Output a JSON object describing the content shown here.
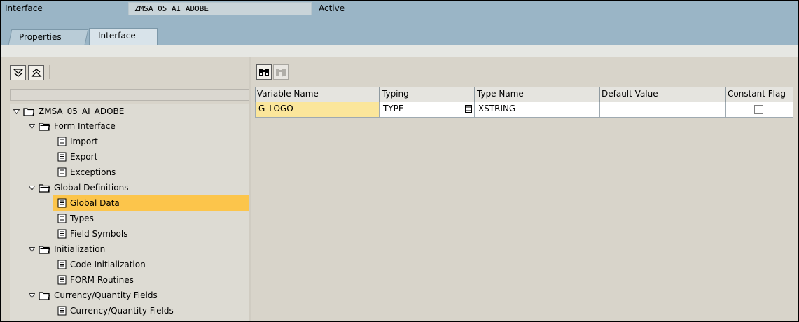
{
  "header": {
    "label": "Interface",
    "value": "ZMSA_05_AI_ADOBE",
    "status": "Active"
  },
  "tabs": [
    {
      "label": "Properties"
    },
    {
      "label": "Interface"
    }
  ],
  "tree": {
    "root": "ZMSA_05_AI_ADOBE",
    "form_interface": {
      "label": "Form Interface",
      "children": [
        "Import",
        "Export",
        "Exceptions"
      ]
    },
    "global_definitions": {
      "label": "Global Definitions",
      "children": [
        "Global Data",
        "Types",
        "Field Symbols"
      ]
    },
    "initialization": {
      "label": "Initialization",
      "children": [
        "Code Initialization",
        "FORM Routines"
      ]
    },
    "currency_quantity": {
      "label": "Currency/Quantity Fields",
      "children": [
        "Currency/Quantity Fields"
      ]
    }
  },
  "grid": {
    "columns": [
      "Variable Name",
      "Typing",
      "Type Name",
      "Default Value",
      "Constant Flag"
    ],
    "rows": [
      {
        "variable_name": "G_LOGO",
        "typing": "TYPE",
        "type_name": "XSTRING",
        "default_value": "",
        "constant_flag": false
      }
    ]
  },
  "colors": {
    "header_bg": "#9ab5c6",
    "selected_node": "#fcc54b",
    "input_cell": "#fbe69b",
    "pane_bg": "#d8d4ca"
  },
  "icons": {
    "expand_all": "expand-all-icon",
    "collapse_all": "collapse-all-icon",
    "find": "binoculars-icon",
    "find_next": "find-next-icon",
    "folder": "folder-open-icon",
    "document": "document-icon"
  }
}
